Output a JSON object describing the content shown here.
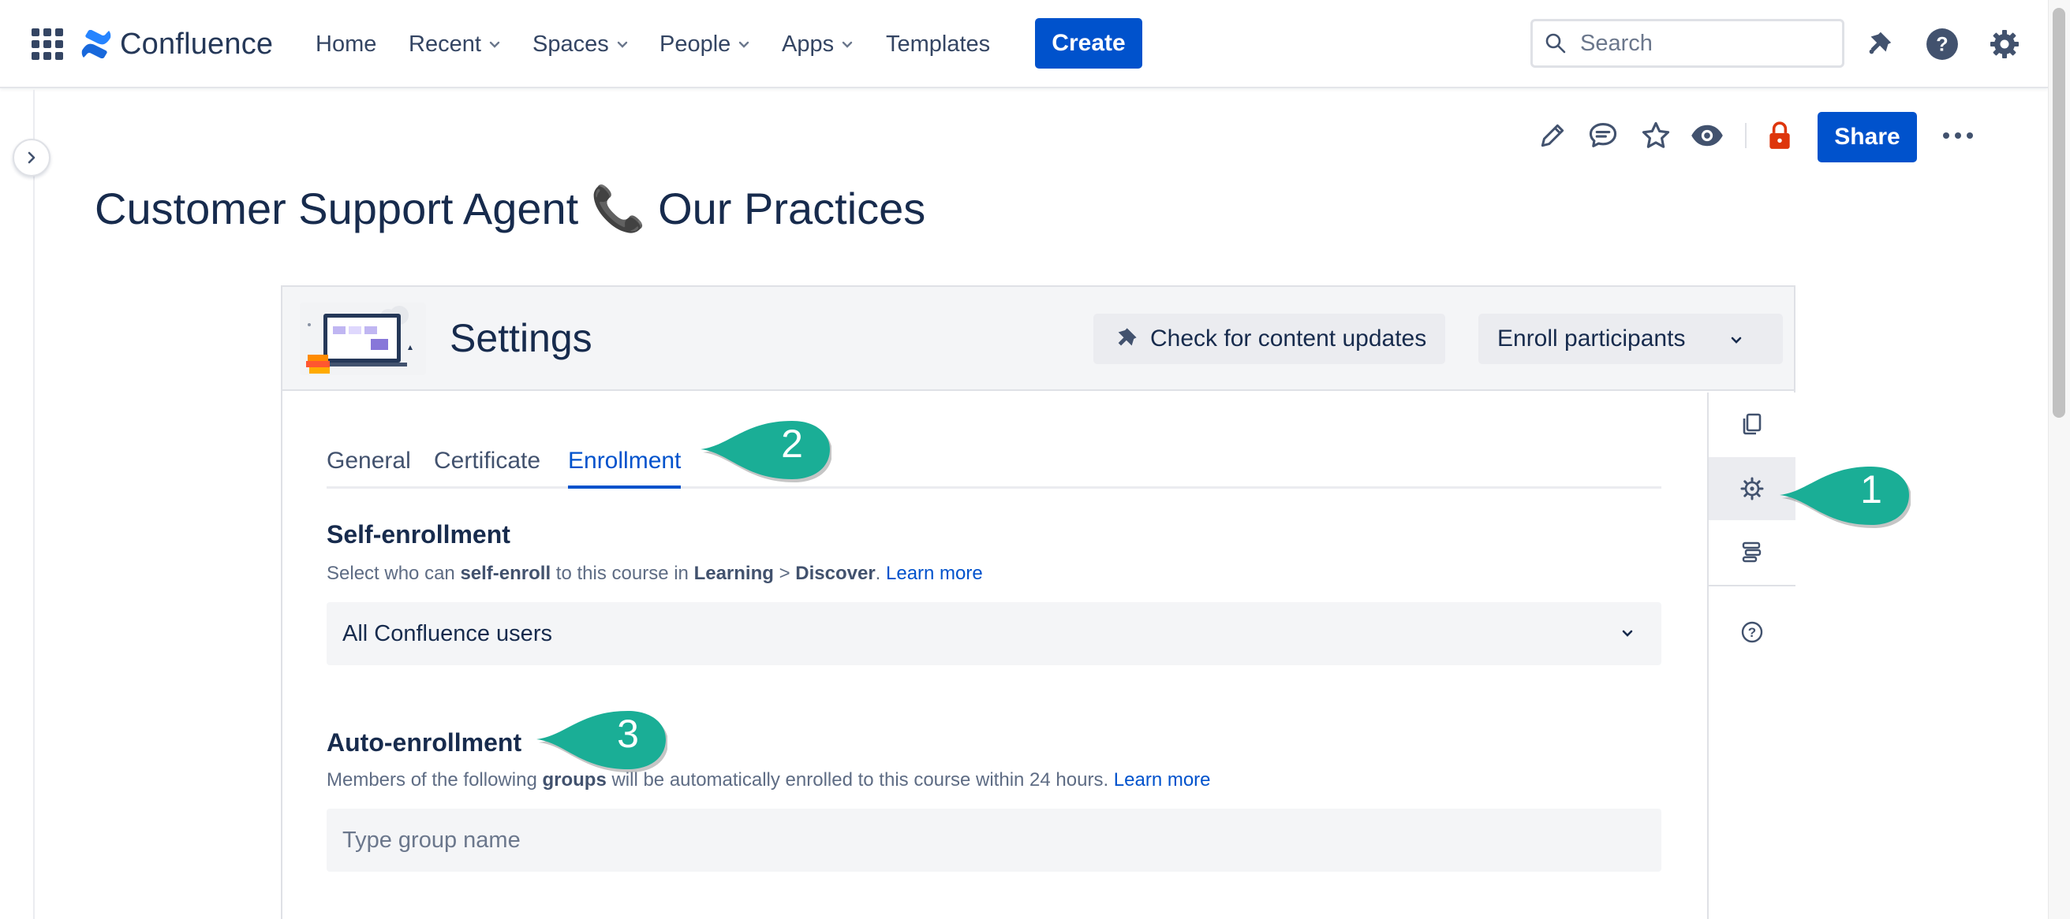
{
  "nav": {
    "logo_text": "Confluence",
    "items": [
      {
        "label": "Home",
        "dropdown": false
      },
      {
        "label": "Recent",
        "dropdown": true
      },
      {
        "label": "Spaces",
        "dropdown": true
      },
      {
        "label": "People",
        "dropdown": true
      },
      {
        "label": "Apps",
        "dropdown": true
      },
      {
        "label": "Templates",
        "dropdown": false
      }
    ],
    "create_label": "Create",
    "search_placeholder": "Search",
    "icons": [
      "app-switcher-icon",
      "notification-bell-icon",
      "help-icon",
      "settings-gear-icon"
    ]
  },
  "page_toolbar": {
    "icons": [
      "edit-pencil-icon",
      "comment-icon",
      "star-icon",
      "watch-eye-icon",
      "restrictions-lock-icon",
      "more-ellipsis-icon"
    ],
    "share_label": "Share"
  },
  "page": {
    "title": "Customer Support Agent 📞 Our Practices"
  },
  "macro": {
    "title": "Settings",
    "check_updates_label": "Check for content updates",
    "enroll_label": "Enroll participants",
    "tabs": [
      "General",
      "Certificate",
      "Enrollment"
    ],
    "active_tab": "Enrollment",
    "self_enrollment": {
      "title": "Self-enrollment",
      "desc_1": "Select who can ",
      "desc_bold_1": "self-enroll",
      "desc_2": " to this course in ",
      "desc_bold_2": "Learning",
      "desc_3": " > ",
      "desc_bold_3": "Discover",
      "desc_4": ". ",
      "learn_more": "Learn more",
      "selected_value": "All Confluence users"
    },
    "auto_enrollment": {
      "title": "Auto-enrollment",
      "desc_1": "Members of the following ",
      "desc_bold": "groups",
      "desc_2": " will be automatically enrolled to this course within 24 hours. ",
      "learn_more": "Learn more",
      "placeholder": "Type group name"
    },
    "side_tools": [
      "copy-icon",
      "settings-gear-icon",
      "structure-icon",
      "help-circle-icon"
    ]
  },
  "callouts": [
    "1",
    "2",
    "3"
  ],
  "colors": {
    "brand_blue": "#0052cc",
    "callout_teal": "#1aae96",
    "text_dark": "#172b4d",
    "lock_red": "#de350b"
  }
}
